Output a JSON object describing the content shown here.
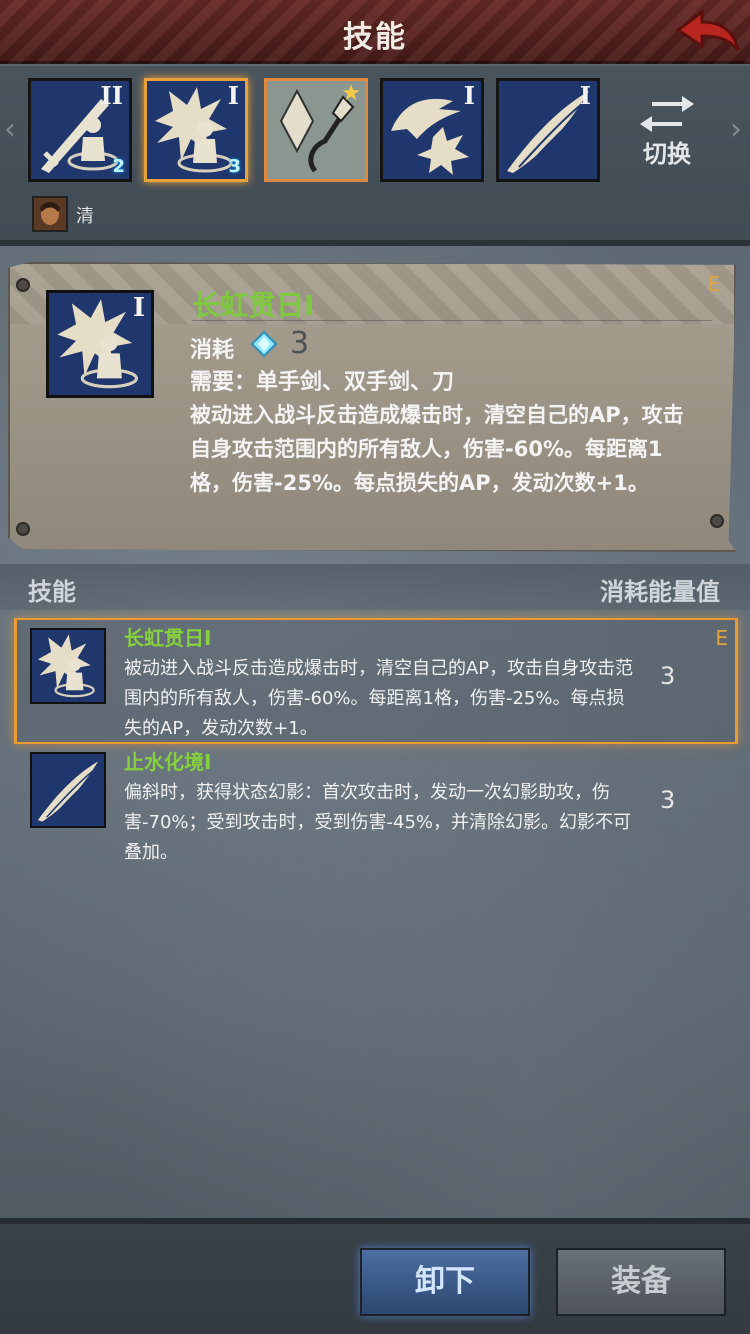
{
  "header": {
    "title": "技能",
    "back_icon": "back-arrow-icon"
  },
  "skill_bar": {
    "slots": [
      {
        "icon": "sword-guard-icon",
        "rank": "II",
        "badge": "2"
      },
      {
        "icon": "burst-guard-icon",
        "rank": "I",
        "badge": "3",
        "selected": true
      },
      {
        "icon": "crystal-hook-icon",
        "star": true
      },
      {
        "icon": "bird-burst-icon",
        "rank": "I"
      },
      {
        "icon": "feather-slash-icon",
        "rank": "I"
      }
    ],
    "switch_label": "切换",
    "hero_name": "清"
  },
  "detail": {
    "rank": "I",
    "name": "长虹贯日I",
    "grade": "E",
    "cost_label": "消耗",
    "cost_value": "3",
    "requirement": "需要：单手剑、双手剑、刀",
    "description": "被动进入战斗反击造成爆击时，清空自己的AP，攻击自身攻击范围内的所有敌人，伤害-60%。每距离1格，伤害-25%。每点损失的AP，发动次数+1。"
  },
  "list_header": {
    "left": "技能",
    "right": "消耗能量值"
  },
  "skills": [
    {
      "title": "长虹贯日I",
      "desc": "被动进入战斗反击造成爆击时，清空自己的AP，攻击自身攻击范围内的所有敌人，伤害-60%。每距离1格，伤害-25%。每点损失的AP，发动次数+1。",
      "cost": "3",
      "grade": "E",
      "selected": true
    },
    {
      "title": "止水化境I",
      "desc": "偏斜时，获得状态幻影：首次攻击时，发动一次幻影助攻，伤害-70%；受到攻击时，受到伤害-45%，并清除幻影。幻影不可叠加。",
      "cost": "3"
    }
  ],
  "buttons": {
    "unequip": "卸下",
    "equip": "装备"
  },
  "colors": {
    "header": "#5a2420",
    "accent_gold": "#e99a33",
    "skill_name_green": "#7fc93f",
    "icon_blue": "#1f3468"
  }
}
